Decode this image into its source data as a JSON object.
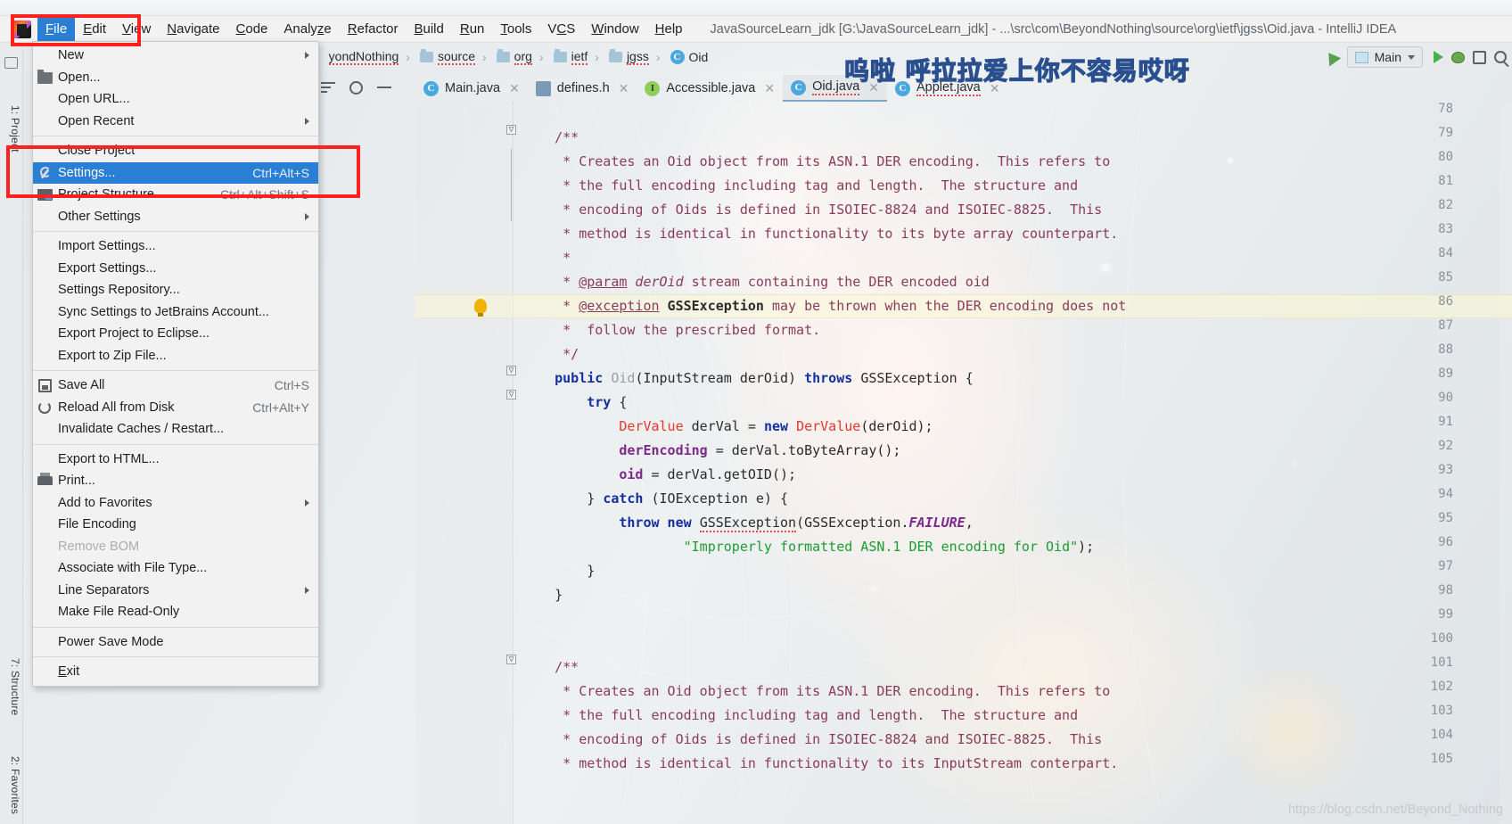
{
  "window": {
    "title": "JavaSourceLearn_jdk [G:\\JavaSourceLearn_jdk] - ...\\src\\com\\BeyondNothing\\source\\org\\ietf\\jgss\\Oid.java - IntelliJ IDEA",
    "logo_name": "intellij-idea-logo"
  },
  "menubar": {
    "items": [
      {
        "label": "File",
        "active": true
      },
      {
        "label": "Edit",
        "active": false
      },
      {
        "label": "View",
        "active": false
      },
      {
        "label": "Navigate",
        "active": false
      },
      {
        "label": "Code",
        "active": false
      },
      {
        "label": "Analyze",
        "active": false
      },
      {
        "label": "Refactor",
        "active": false
      },
      {
        "label": "Build",
        "active": false
      },
      {
        "label": "Run",
        "active": false
      },
      {
        "label": "Tools",
        "active": false
      },
      {
        "label": "VCS",
        "active": false
      },
      {
        "label": "Window",
        "active": false
      },
      {
        "label": "Help",
        "active": false
      }
    ]
  },
  "file_menu": {
    "items": [
      {
        "label": "New",
        "shortcut": "",
        "icon": "",
        "submenu": true,
        "selected": false,
        "disabled": false
      },
      {
        "label": "Open...",
        "shortcut": "",
        "icon": "folder-icon",
        "submenu": false,
        "selected": false,
        "disabled": false
      },
      {
        "label": "Open URL...",
        "shortcut": "",
        "icon": "",
        "submenu": false,
        "selected": false,
        "disabled": false
      },
      {
        "label": "Open Recent",
        "shortcut": "",
        "icon": "",
        "submenu": true,
        "selected": false,
        "disabled": false
      },
      {
        "separator": true
      },
      {
        "label": "Close Project",
        "shortcut": "",
        "icon": "",
        "submenu": false,
        "selected": false,
        "disabled": false
      },
      {
        "label": "Settings...",
        "shortcut": "Ctrl+Alt+S",
        "icon": "wrench-icon",
        "submenu": false,
        "selected": true,
        "disabled": false
      },
      {
        "label": "Project Structure...",
        "shortcut": "Ctrl+Alt+Shift+S",
        "icon": "project-structure-icon",
        "submenu": false,
        "selected": false,
        "disabled": false
      },
      {
        "label": "Other Settings",
        "shortcut": "",
        "icon": "",
        "submenu": true,
        "selected": false,
        "disabled": false
      },
      {
        "separator": true
      },
      {
        "label": "Import Settings...",
        "shortcut": "",
        "icon": "",
        "submenu": false,
        "selected": false,
        "disabled": false
      },
      {
        "label": "Export Settings...",
        "shortcut": "",
        "icon": "",
        "submenu": false,
        "selected": false,
        "disabled": false
      },
      {
        "label": "Settings Repository...",
        "shortcut": "",
        "icon": "",
        "submenu": false,
        "selected": false,
        "disabled": false
      },
      {
        "label": "Sync Settings to JetBrains Account...",
        "shortcut": "",
        "icon": "",
        "submenu": false,
        "selected": false,
        "disabled": false
      },
      {
        "label": "Export Project to Eclipse...",
        "shortcut": "",
        "icon": "",
        "submenu": false,
        "selected": false,
        "disabled": false
      },
      {
        "label": "Export to Zip File...",
        "shortcut": "",
        "icon": "",
        "submenu": false,
        "selected": false,
        "disabled": false
      },
      {
        "separator": true
      },
      {
        "label": "Save All",
        "shortcut": "Ctrl+S",
        "icon": "save-icon",
        "submenu": false,
        "selected": false,
        "disabled": false
      },
      {
        "label": "Reload All from Disk",
        "shortcut": "Ctrl+Alt+Y",
        "icon": "reload-icon",
        "submenu": false,
        "selected": false,
        "disabled": false
      },
      {
        "label": "Invalidate Caches / Restart...",
        "shortcut": "",
        "icon": "",
        "submenu": false,
        "selected": false,
        "disabled": false
      },
      {
        "separator": true
      },
      {
        "label": "Export to HTML...",
        "shortcut": "",
        "icon": "",
        "submenu": false,
        "selected": false,
        "disabled": false
      },
      {
        "label": "Print...",
        "shortcut": "",
        "icon": "print-icon",
        "submenu": false,
        "selected": false,
        "disabled": false
      },
      {
        "label": "Add to Favorites",
        "shortcut": "",
        "icon": "",
        "submenu": true,
        "selected": false,
        "disabled": false
      },
      {
        "label": "File Encoding",
        "shortcut": "",
        "icon": "",
        "submenu": false,
        "selected": false,
        "disabled": false
      },
      {
        "label": "Remove BOM",
        "shortcut": "",
        "icon": "",
        "submenu": false,
        "selected": false,
        "disabled": true
      },
      {
        "label": "Associate with File Type...",
        "shortcut": "",
        "icon": "",
        "submenu": false,
        "selected": false,
        "disabled": false
      },
      {
        "label": "Line Separators",
        "shortcut": "",
        "icon": "",
        "submenu": true,
        "selected": false,
        "disabled": false
      },
      {
        "label": "Make File Read-Only",
        "shortcut": "",
        "icon": "",
        "submenu": false,
        "selected": false,
        "disabled": false
      },
      {
        "separator": true
      },
      {
        "label": "Power Save Mode",
        "shortcut": "",
        "icon": "",
        "submenu": false,
        "selected": false,
        "disabled": false
      },
      {
        "separator": true
      },
      {
        "label": "Exit",
        "shortcut": "",
        "icon": "",
        "submenu": false,
        "selected": false,
        "disabled": false
      }
    ]
  },
  "breadcrumbs": {
    "items": [
      {
        "label": "yondNothing",
        "icon": "",
        "misspelled": true
      },
      {
        "label": "source",
        "icon": "folder-icon",
        "misspelled": true
      },
      {
        "label": "org",
        "icon": "folder-icon",
        "misspelled": true
      },
      {
        "label": "ietf",
        "icon": "folder-icon",
        "misspelled": true
      },
      {
        "label": "jgss",
        "icon": "folder-icon",
        "misspelled": true
      },
      {
        "label": "Oid",
        "icon": "class-icon",
        "misspelled": false
      }
    ]
  },
  "run_config": {
    "name": "Main",
    "icons": [
      "build-hammer-icon",
      "run-icon",
      "debug-icon",
      "coverage-icon",
      "search-everywhere-icon"
    ]
  },
  "editor_tabs": [
    {
      "label": "Main.java",
      "icon": "java-class-runnable-icon",
      "selected": false,
      "closable": true
    },
    {
      "label": "defines.h",
      "icon": "header-file-icon",
      "selected": false,
      "closable": true
    },
    {
      "label": "Accessible.java",
      "icon": "java-interface-icon",
      "selected": false,
      "closable": true
    },
    {
      "label": "Oid.java",
      "icon": "java-class-icon",
      "selected": true,
      "closable": true
    },
    {
      "label": "Applet.java",
      "icon": "java-class-icon",
      "selected": false,
      "closable": true
    }
  ],
  "tool_windows": {
    "left": [
      {
        "label": "1: Project"
      },
      {
        "label": "7: Structure"
      },
      {
        "label": "2: Favorites"
      }
    ]
  },
  "editor": {
    "file": "Oid.java",
    "first_line": 78,
    "highlighted_line": 86,
    "lines": [
      {
        "n": 78,
        "text": ""
      },
      {
        "n": 79,
        "text": "    /**"
      },
      {
        "n": 80,
        "text": "     * Creates an Oid object from its ASN.1 DER encoding.  This refers to"
      },
      {
        "n": 81,
        "text": "     * the full encoding including tag and length.  The structure and"
      },
      {
        "n": 82,
        "text": "     * encoding of Oids is defined in ISOIEC-8824 and ISOIEC-8825.  This"
      },
      {
        "n": 83,
        "text": "     * method is identical in functionality to its byte array counterpart."
      },
      {
        "n": 84,
        "text": "     *"
      },
      {
        "n": 85,
        "text": "     * @param derOid stream containing the DER encoded oid"
      },
      {
        "n": 86,
        "text": "     * @exception GSSException may be thrown when the DER encoding does not"
      },
      {
        "n": 87,
        "text": "     *  follow the prescribed format."
      },
      {
        "n": 88,
        "text": "     */"
      },
      {
        "n": 89,
        "text": "    public Oid(InputStream derOid) throws GSSException {"
      },
      {
        "n": 90,
        "text": "        try {"
      },
      {
        "n": 91,
        "text": "            DerValue derVal = new DerValue(derOid);"
      },
      {
        "n": 92,
        "text": "            derEncoding = derVal.toByteArray();"
      },
      {
        "n": 93,
        "text": "            oid = derVal.getOID();"
      },
      {
        "n": 94,
        "text": "        } catch (IOException e) {"
      },
      {
        "n": 95,
        "text": "            throw new GSSException(GSSException.FAILURE,"
      },
      {
        "n": 96,
        "text": "                    \"Improperly formatted ASN.1 DER encoding for Oid\");"
      },
      {
        "n": 97,
        "text": "        }"
      },
      {
        "n": 98,
        "text": "    }"
      },
      {
        "n": 99,
        "text": ""
      },
      {
        "n": 100,
        "text": ""
      },
      {
        "n": 101,
        "text": "    /**"
      },
      {
        "n": 102,
        "text": "     * Creates an Oid object from its ASN.1 DER encoding.  This refers to"
      },
      {
        "n": 103,
        "text": "     * the full encoding including tag and length.  The structure and"
      },
      {
        "n": 104,
        "text": "     * encoding of Oids is defined in ISOIEC-8824 and ISOIEC-8825.  This"
      },
      {
        "n": 105,
        "text": "     * method is identical in functionality to its InputStream conterpart."
      }
    ]
  },
  "annotations": {
    "watermark_cn": "呜啦  呼拉拉爱上你不容易哎呀",
    "watermark_url": "https://blog.csdn.net/Beyond_Nothing",
    "highlight_boxes": [
      {
        "name": "file-menu-button-highlight"
      },
      {
        "name": "settings-menu-item-highlight"
      }
    ]
  }
}
